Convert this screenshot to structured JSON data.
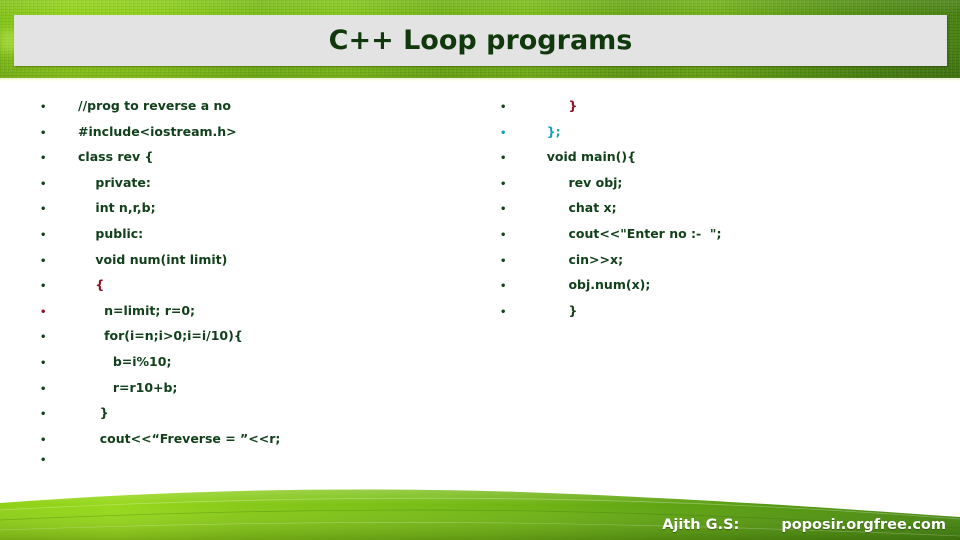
{
  "slide": {
    "title": "C++ Loop programs"
  },
  "colors": {
    "title_text": "#10380c",
    "title_plate": "#e3e3e3",
    "code_green": "#11401a",
    "code_cyan": "#14a3b8",
    "code_red": "#8f1020",
    "grass_light": "#93d41a",
    "grass_dark": "#46800f",
    "footer_text": "#ffffff"
  },
  "code": {
    "left_column": [
      {
        "bullet": "•",
        "text": "//prog to reverse a no",
        "indent": 0,
        "color": "green",
        "bullet_color": "green"
      },
      {
        "bullet": "•",
        "text": "#include<iostream.h>",
        "indent": 0,
        "color": "green",
        "bullet_color": "green"
      },
      {
        "bullet": "•",
        "text": "class rev {",
        "indent": 0,
        "color": "green",
        "bullet_color": "green"
      },
      {
        "bullet": "•",
        "text": "    private:",
        "indent": 0,
        "color": "green",
        "bullet_color": "green"
      },
      {
        "bullet": "•",
        "text": "    int n,r,b;",
        "indent": 0,
        "color": "green",
        "bullet_color": "green"
      },
      {
        "bullet": "•",
        "text": "    public:",
        "indent": 0,
        "color": "green",
        "bullet_color": "green"
      },
      {
        "bullet": "•",
        "text": "    void num(int limit)",
        "indent": 0,
        "color": "green",
        "bullet_color": "green"
      },
      {
        "bullet": "•",
        "text": "    {",
        "indent": 0,
        "color": "red",
        "bullet_color": "green"
      },
      {
        "bullet": "•",
        "text": "      n=limit; r=0;",
        "indent": 0,
        "color": "green",
        "bullet_color": "red"
      },
      {
        "bullet": "•",
        "text": "      for(i=n;i>0;i=i/10){",
        "indent": 0,
        "color": "green",
        "bullet_color": "green"
      },
      {
        "bullet": "•",
        "text": "        b=i%10;",
        "indent": 0,
        "color": "green",
        "bullet_color": "green"
      },
      {
        "bullet": "•",
        "text": "        r=r10+b;",
        "indent": 0,
        "color": "green",
        "bullet_color": "green"
      },
      {
        "bullet": "•",
        "text": "     }",
        "indent": 0,
        "color": "green",
        "bullet_color": "green"
      },
      {
        "bullet": "•",
        "text": "     cout<<“Freverse = ”<<r;",
        "indent": 0,
        "color": "green",
        "bullet_color": "green"
      },
      {
        "bullet": "•",
        "text": "",
        "indent": 0,
        "color": "green",
        "bullet_color": "green"
      }
    ],
    "right_column": [
      {
        "bullet": "•",
        "text": "       }",
        "indent": 0,
        "color": "red",
        "bullet_color": "green"
      },
      {
        "bullet": "•",
        "text": "  };",
        "indent": 0,
        "color": "cyan",
        "bullet_color": "cyan"
      },
      {
        "bullet": "•",
        "text": "  void main(){",
        "indent": 0,
        "color": "green",
        "bullet_color": "green"
      },
      {
        "bullet": "•",
        "text": "       rev obj;",
        "indent": 0,
        "color": "green",
        "bullet_color": "green"
      },
      {
        "bullet": "•",
        "text": "       chat x;",
        "indent": 0,
        "color": "green",
        "bullet_color": "green"
      },
      {
        "bullet": "•",
        "text": "       cout<<\"Enter no :-  \";",
        "indent": 0,
        "color": "green",
        "bullet_color": "green"
      },
      {
        "bullet": "•",
        "text": "       cin>>x;",
        "indent": 0,
        "color": "green",
        "bullet_color": "green"
      },
      {
        "bullet": "•",
        "text": "       obj.num(x);",
        "indent": 0,
        "color": "green",
        "bullet_color": "green"
      },
      {
        "bullet": "•",
        "text": "       }",
        "indent": 0,
        "color": "green",
        "bullet_color": "green"
      }
    ]
  },
  "footer": {
    "author": "Ajith G.S:",
    "site": "poposir.orgfree.com"
  }
}
